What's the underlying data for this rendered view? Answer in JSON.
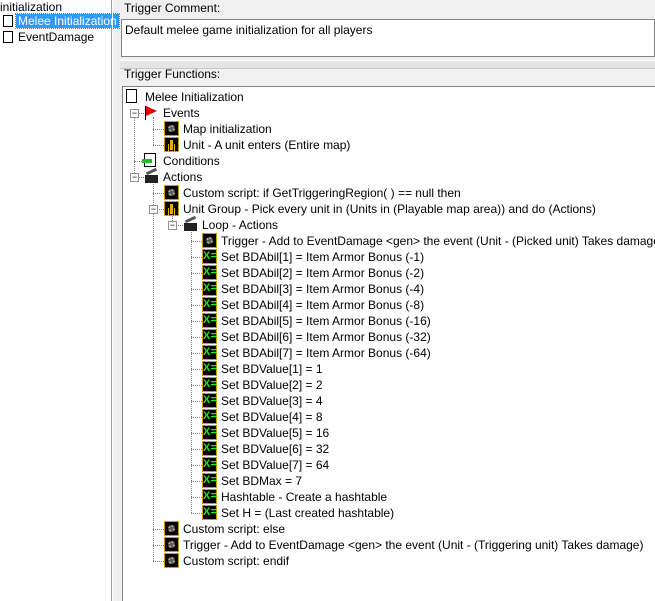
{
  "left_panel": {
    "items": [
      {
        "label": "initialization",
        "selected": false,
        "icon": "none"
      },
      {
        "label": "Melee Initialization",
        "selected": true,
        "icon": "document-icon"
      },
      {
        "label": "EventDamage",
        "selected": false,
        "icon": "document-icon"
      }
    ]
  },
  "comment": {
    "label": "Trigger Comment:",
    "value": "Default melee game initialization for all players"
  },
  "functions": {
    "label": "Trigger Functions:",
    "tree": [
      {
        "level": 0,
        "icon": "doc",
        "text": "Melee Initialization"
      },
      {
        "level": 1,
        "icon": "flag",
        "text": "Events",
        "expanded": true
      },
      {
        "level": 2,
        "icon": "gear",
        "text": "Map initialization"
      },
      {
        "level": 2,
        "icon": "unit",
        "text": "Unit - A unit enters (Entire map)"
      },
      {
        "level": 1,
        "icon": "cond",
        "text": "Conditions"
      },
      {
        "level": 1,
        "icon": "clap",
        "text": "Actions",
        "expanded": true
      },
      {
        "level": 2,
        "icon": "gear",
        "text": "Custom script:   if GetTriggeringRegion( ) == null then"
      },
      {
        "level": 2,
        "icon": "unit",
        "text": "Unit Group - Pick every unit in (Units in (Playable map area)) and do (Actions)",
        "expanded": true
      },
      {
        "level": 3,
        "icon": "clap",
        "text": "Loop - Actions",
        "expanded": true
      },
      {
        "level": 4,
        "icon": "gear",
        "text": "Trigger - Add to EventDamage <gen> the event (Unit - (Picked unit) Takes damage)"
      },
      {
        "level": 4,
        "icon": "set",
        "text": "Set BDAbil[1] = Item Armor Bonus (-1)"
      },
      {
        "level": 4,
        "icon": "set",
        "text": "Set BDAbil[2] = Item Armor Bonus (-2)"
      },
      {
        "level": 4,
        "icon": "set",
        "text": "Set BDAbil[3] = Item Armor Bonus (-4)"
      },
      {
        "level": 4,
        "icon": "set",
        "text": "Set BDAbil[4] = Item Armor Bonus (-8)"
      },
      {
        "level": 4,
        "icon": "set",
        "text": "Set BDAbil[5] = Item Armor Bonus (-16)"
      },
      {
        "level": 4,
        "icon": "set",
        "text": "Set BDAbil[6] = Item Armor Bonus (-32)"
      },
      {
        "level": 4,
        "icon": "set",
        "text": "Set BDAbil[7] = Item Armor Bonus (-64)"
      },
      {
        "level": 4,
        "icon": "set",
        "text": "Set BDValue[1] = 1"
      },
      {
        "level": 4,
        "icon": "set",
        "text": "Set BDValue[2] = 2"
      },
      {
        "level": 4,
        "icon": "set",
        "text": "Set BDValue[3] = 4"
      },
      {
        "level": 4,
        "icon": "set",
        "text": "Set BDValue[4] = 8"
      },
      {
        "level": 4,
        "icon": "set",
        "text": "Set BDValue[5] = 16"
      },
      {
        "level": 4,
        "icon": "set",
        "text": "Set BDValue[6] = 32"
      },
      {
        "level": 4,
        "icon": "set",
        "text": "Set BDValue[7] = 64"
      },
      {
        "level": 4,
        "icon": "set",
        "text": "Set BDMax = 7"
      },
      {
        "level": 4,
        "icon": "set",
        "text": "Hashtable - Create a hashtable"
      },
      {
        "level": 4,
        "icon": "set",
        "text": "Set H = (Last created hashtable)"
      },
      {
        "level": 2,
        "icon": "gear",
        "text": "Custom script:   else"
      },
      {
        "level": 2,
        "icon": "gear",
        "text": "Trigger - Add to EventDamage <gen> the event (Unit - (Triggering unit) Takes damage)"
      },
      {
        "level": 2,
        "icon": "gear",
        "text": "Custom script:   endif"
      }
    ]
  }
}
